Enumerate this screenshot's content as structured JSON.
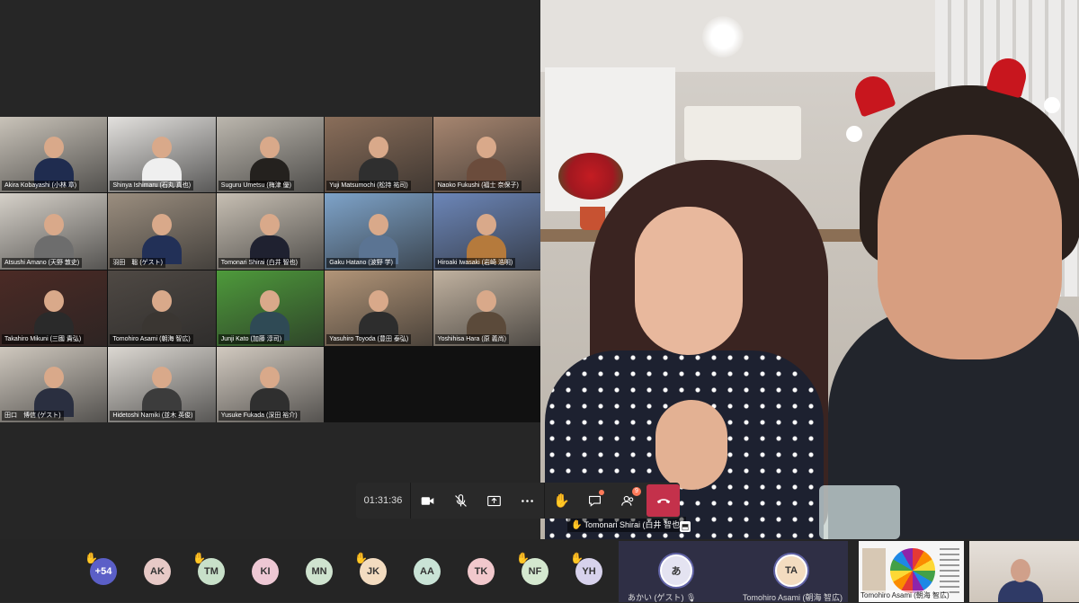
{
  "grid": [
    {
      "name": "Akira Kobayashi (小林 章)",
      "bg": "#c9c3b9",
      "shirt": "#1f2c4f"
    },
    {
      "name": "Shinya Ishimaru (石丸 真也)",
      "bg": "#e3e1de",
      "shirt": "#efefef"
    },
    {
      "name": "Suguru Umetsu (梅津 優)",
      "bg": "#bcb7ae",
      "shirt": "#24211e"
    },
    {
      "name": "Yuji Matsumochi (松持 祐司)",
      "bg": "#8a6e5a",
      "shirt": "#2f2f2f"
    },
    {
      "name": "Naoko Fukushi (福士 奈保子)",
      "bg": "#a78670",
      "shirt": "#6b4c3c"
    },
    {
      "name": "Atsushi Amano (天野 敦史)",
      "bg": "#d6d1c9",
      "shirt": "#6d6d6d"
    },
    {
      "name": "羽田　聡 (ゲスト)",
      "bg": "#9b8e7f",
      "shirt": "#223057"
    },
    {
      "name": "Tomonari Shirai (白井 智也)",
      "bg": "#c7bfb3",
      "shirt": "#1f2130"
    },
    {
      "name": "Gaku Hatano (波野 学)",
      "bg": "#7ea3c9",
      "shirt": "#5b7493"
    },
    {
      "name": "Hiroaki Iwasaki (岩崎 浩明)",
      "bg": "#6c86b8",
      "shirt": "#b57a3c"
    },
    {
      "name": "Takahiro Mikuni (三國 貴弘)",
      "bg": "#4b2a25",
      "shirt": "#2a2a2a"
    },
    {
      "name": "Tomohiro Asami (朝海 智広)",
      "bg": "#4f4944",
      "shirt": "#3a3632"
    },
    {
      "name": "Junji Kato (加藤 淳司)",
      "bg": "#4e9a3b",
      "shirt": "#2f4a55"
    },
    {
      "name": "Yasuhiro Toyoda (豊田 泰弘)",
      "bg": "#b29578",
      "shirt": "#2d2d2d"
    },
    {
      "name": "Yoshihisa Hara (原 義尚)",
      "bg": "#c1b2a0",
      "shirt": "#5b4a3a"
    },
    {
      "name": "田口　博信 (ゲスト)",
      "bg": "#cfc8be",
      "shirt": "#2a2f40"
    },
    {
      "name": "Hidetoshi Namiki (並木 英俊)",
      "bg": "#dcd8d2",
      "shirt": "#3c3c3c"
    },
    {
      "name": "Yusuke Fukada (深田 裕介)",
      "bg": "#d2cac0",
      "shirt": "#2f2f2f"
    }
  ],
  "main": {
    "speaker_name": "Tomonari Shirai (白井 智也)",
    "hand_icon": "raise-hand-icon"
  },
  "controls": {
    "timer": "01:31:36",
    "chat_badge": "dot",
    "participants_count": "9"
  },
  "bottom": {
    "overflow": "+54",
    "avatars": [
      {
        "initials": "AK",
        "color": "#e7c9c6",
        "hand": false
      },
      {
        "initials": "TM",
        "color": "#c8e0c9",
        "hand": true
      },
      {
        "initials": "KI",
        "color": "#eec8d4",
        "hand": false
      },
      {
        "initials": "MN",
        "color": "#cfe3cf",
        "hand": false
      },
      {
        "initials": "JK",
        "color": "#f3dcc0",
        "hand": true
      },
      {
        "initials": "AA",
        "color": "#c9e3d6",
        "hand": false
      },
      {
        "initials": "TK",
        "color": "#f1c8cc",
        "hand": false
      },
      {
        "initials": "NF",
        "color": "#d4e8cf",
        "hand": true
      },
      {
        "initials": "YH",
        "color": "#d7d2ec",
        "hand": true
      }
    ],
    "guest1": {
      "initials": "あ",
      "name": "あかい (ゲスト)",
      "color": "#e4e3f1"
    },
    "guest2": {
      "initials": "TA",
      "name": "Tomohiro Asami (朝海 智広)",
      "color": "#f3dcc0"
    },
    "thumb1_name": "Tomohiro Asami (朝海 智広)"
  }
}
